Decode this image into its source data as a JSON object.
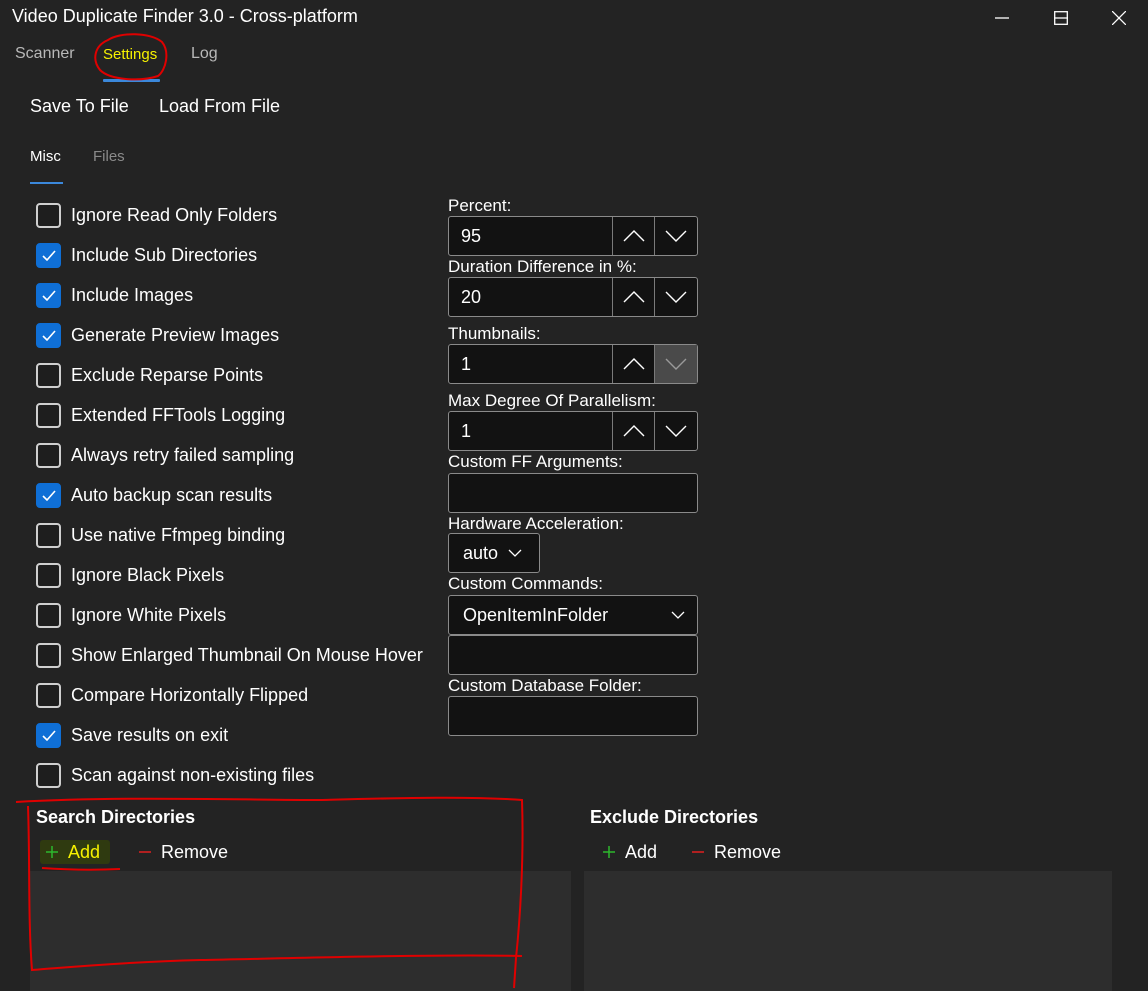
{
  "window": {
    "title": "Video Duplicate Finder 3.0 - Cross-platform",
    "controls": [
      "minimize",
      "maximize",
      "close"
    ]
  },
  "top_tabs": [
    {
      "label": "Scanner",
      "active": false
    },
    {
      "label": "Settings",
      "active": true
    },
    {
      "label": "Log",
      "active": false
    }
  ],
  "toolbar": {
    "save_label": "Save To File",
    "load_label": "Load From File"
  },
  "sub_tabs": [
    {
      "label": "Misc",
      "active": true
    },
    {
      "label": "Files",
      "active": false
    }
  ],
  "options": [
    {
      "label": "Ignore Read Only Folders",
      "checked": false
    },
    {
      "label": "Include Sub Directories",
      "checked": true
    },
    {
      "label": "Include Images",
      "checked": true
    },
    {
      "label": "Generate Preview Images",
      "checked": true
    },
    {
      "label": "Exclude Reparse Points",
      "checked": false
    },
    {
      "label": "Extended FFTools Logging",
      "checked": false
    },
    {
      "label": "Always retry failed sampling",
      "checked": false
    },
    {
      "label": "Auto backup scan results",
      "checked": true
    },
    {
      "label": "Use native Ffmpeg binding",
      "checked": false
    },
    {
      "label": "Ignore Black Pixels",
      "checked": false
    },
    {
      "label": "Ignore White Pixels",
      "checked": false
    },
    {
      "label": "Show Enlarged Thumbnail On Mouse Hover",
      "checked": false
    },
    {
      "label": "Compare Horizontally Flipped",
      "checked": false
    },
    {
      "label": "Save results on exit",
      "checked": true
    },
    {
      "label": "Scan against non-existing files",
      "checked": false
    }
  ],
  "fields": {
    "percent": {
      "label": "Percent:",
      "value": "95"
    },
    "duration": {
      "label": "Duration Difference in %:",
      "value": "20"
    },
    "thumbnails": {
      "label": "Thumbnails:",
      "value": "1"
    },
    "parallelism": {
      "label": "Max Degree Of Parallelism:",
      "value": "1"
    },
    "ff_args": {
      "label": "Custom FF Arguments:",
      "value": ""
    },
    "hw_accel": {
      "label": "Hardware Acceleration:",
      "value": "auto"
    },
    "custom_commands": {
      "label": "Custom Commands:",
      "value": "OpenItemInFolder",
      "extra_value": ""
    },
    "db_folder": {
      "label": "Custom Database Folder:",
      "value": ""
    }
  },
  "search_dirs": {
    "title": "Search Directories",
    "add_label": "Add",
    "remove_label": "Remove"
  },
  "exclude_dirs": {
    "title": "Exclude Directories",
    "add_label": "Add",
    "remove_label": "Remove"
  },
  "colors": {
    "background": "#232323",
    "accent": "#3b88db",
    "checkbox_checked": "#0f6fd6",
    "highlight_text": "#f6f200",
    "annotation": "#e00000",
    "add_icon": "#2db82d",
    "remove_icon": "#e02020"
  }
}
